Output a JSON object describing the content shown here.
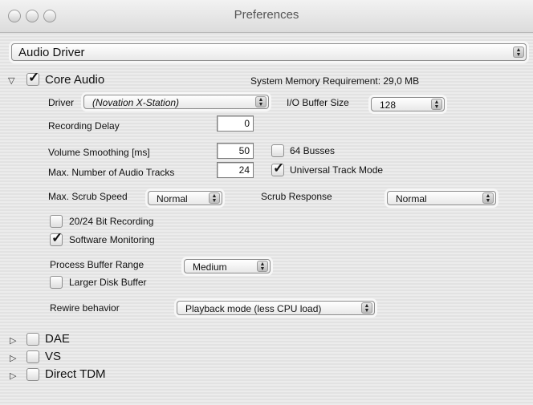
{
  "window": {
    "title": "Preferences"
  },
  "category_select": {
    "value": "Audio Driver"
  },
  "core_audio": {
    "label": "Core Audio",
    "checked": true,
    "memory_requirement": "System Memory Requirement: 29,0 MB",
    "driver_label": "Driver",
    "driver_value": "(Novation X-Station)",
    "io_buffer_label": "I/O Buffer Size",
    "io_buffer_value": "128",
    "recording_delay_label": "Recording Delay",
    "recording_delay_value": "0",
    "volume_smoothing_label": "Volume Smoothing [ms]",
    "volume_smoothing_value": "50",
    "max_tracks_label": "Max. Number of Audio Tracks",
    "max_tracks_value": "24",
    "busses_label": "64 Busses",
    "universal_track_label": "Universal Track Mode",
    "scrub_speed_label": "Max. Scrub Speed",
    "scrub_speed_value": "Normal",
    "scrub_response_label": "Scrub Response",
    "scrub_response_value": "Normal",
    "bit_recording_label": "20/24 Bit Recording",
    "software_monitoring_label": "Software Monitoring",
    "process_buffer_label": "Process Buffer Range",
    "process_buffer_value": "Medium",
    "larger_disk_label": "Larger Disk Buffer",
    "rewire_label": "Rewire behavior",
    "rewire_value": "Playback mode (less CPU load)"
  },
  "drivers": [
    {
      "label": "DAE"
    },
    {
      "label": "VS"
    },
    {
      "label": "Direct TDM"
    }
  ]
}
